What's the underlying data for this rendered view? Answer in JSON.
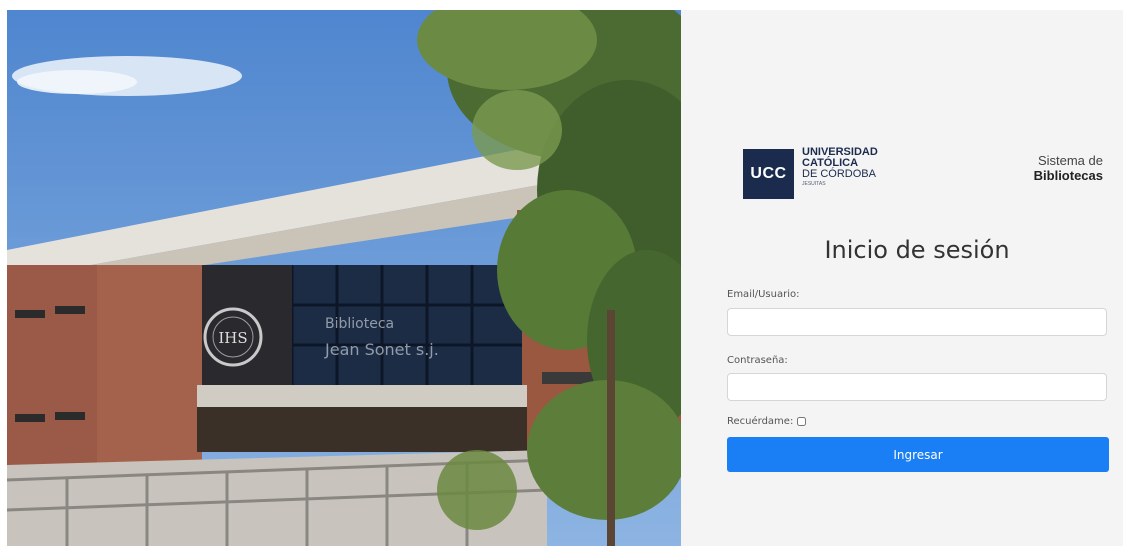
{
  "brand": {
    "logo_abbr": "UCC",
    "university_line1": "UNIVERSIDAD",
    "university_line2": "CATÓLICA",
    "university_line3": "DE CÓRDOBA",
    "university_line4": "JESUITAS",
    "system_line1": "Sistema de",
    "system_line2": "Bibliotecas"
  },
  "photo": {
    "building_sign_line1": "Biblioteca",
    "building_sign_line2": "Jean Sonet s.j.",
    "emblem_text": "IHS"
  },
  "login": {
    "title": "Inicio de sesión",
    "email_label": "Email/Usuario:",
    "email_value": "",
    "password_label": "Contraseña:",
    "password_value": "",
    "remember_label": "Recuérdame:",
    "remember_checked": false,
    "submit_label": "Ingresar"
  },
  "colors": {
    "brand_navy": "#1b2b4e",
    "primary_button": "#1a7ef5",
    "panel_background": "#f4f4f4"
  }
}
